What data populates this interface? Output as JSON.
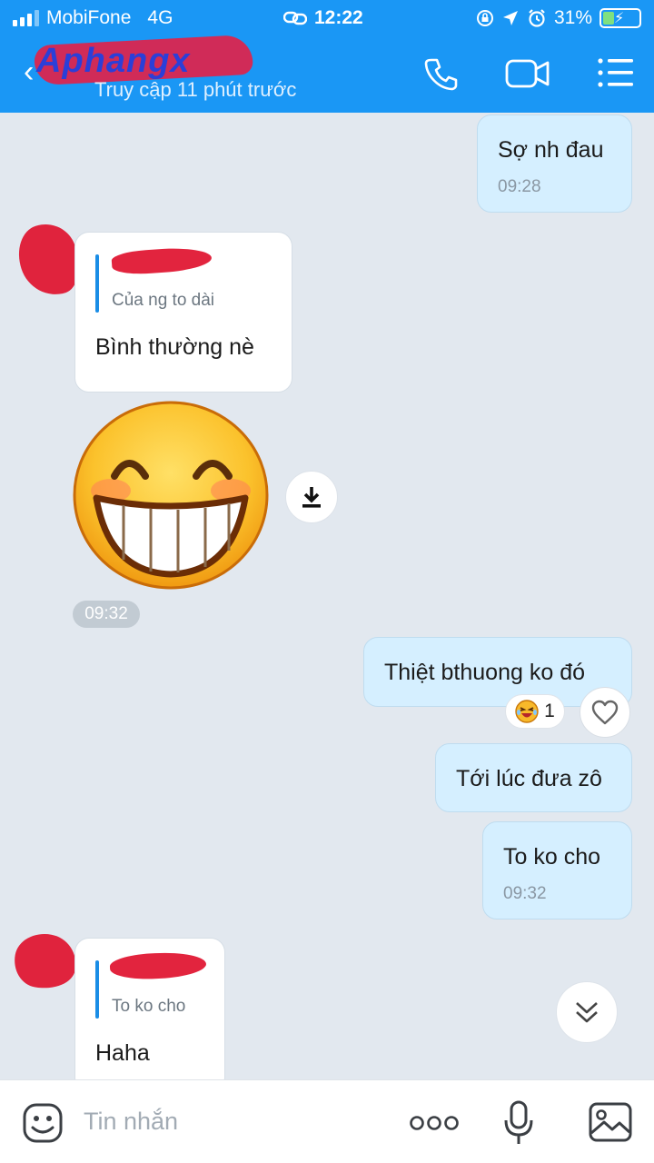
{
  "status_bar": {
    "carrier": "MobiFone",
    "network": "4G",
    "time": "12:22",
    "battery": "31%",
    "battery_level": 0.31,
    "icons": [
      "signal-icon",
      "link-icon",
      "screen-lock-icon",
      "location-icon",
      "alarm-icon",
      "battery-icon"
    ]
  },
  "header": {
    "logo": "Aphangx",
    "subtitle": "Truy cập 11 phút trước",
    "icons": [
      "back-icon",
      "phone-icon",
      "video-call-icon",
      "menu-icon"
    ]
  },
  "messages": [
    {
      "from": "me",
      "text": "Sợ nh đau",
      "time": "09:28"
    },
    {
      "from": "them",
      "quote": "Của ng to dài",
      "text": "Bình thường nè"
    },
    {
      "from": "them",
      "type": "sticker",
      "sticker": "grinning-face-sticker",
      "time": "09:32"
    },
    {
      "from": "me",
      "text": "Thiệt bthuong ko đó",
      "reaction_count": "1"
    },
    {
      "from": "me",
      "text": "Tới lúc đưa zô"
    },
    {
      "from": "me",
      "text": "To ko cho",
      "time": "09:32"
    },
    {
      "from": "them",
      "quote": "To ko cho",
      "text": "Haha"
    }
  ],
  "input": {
    "placeholder": "Tin nhắn",
    "icons": [
      "sticker-icon",
      "more-icon",
      "microphone-icon",
      "image-icon"
    ]
  },
  "colors": {
    "header": "#1a97f5",
    "background": "#e2e8ef",
    "outgoing_bubble": "#d5efff",
    "incoming_bubble": "#ffffff",
    "accent": "#1a8de6"
  }
}
